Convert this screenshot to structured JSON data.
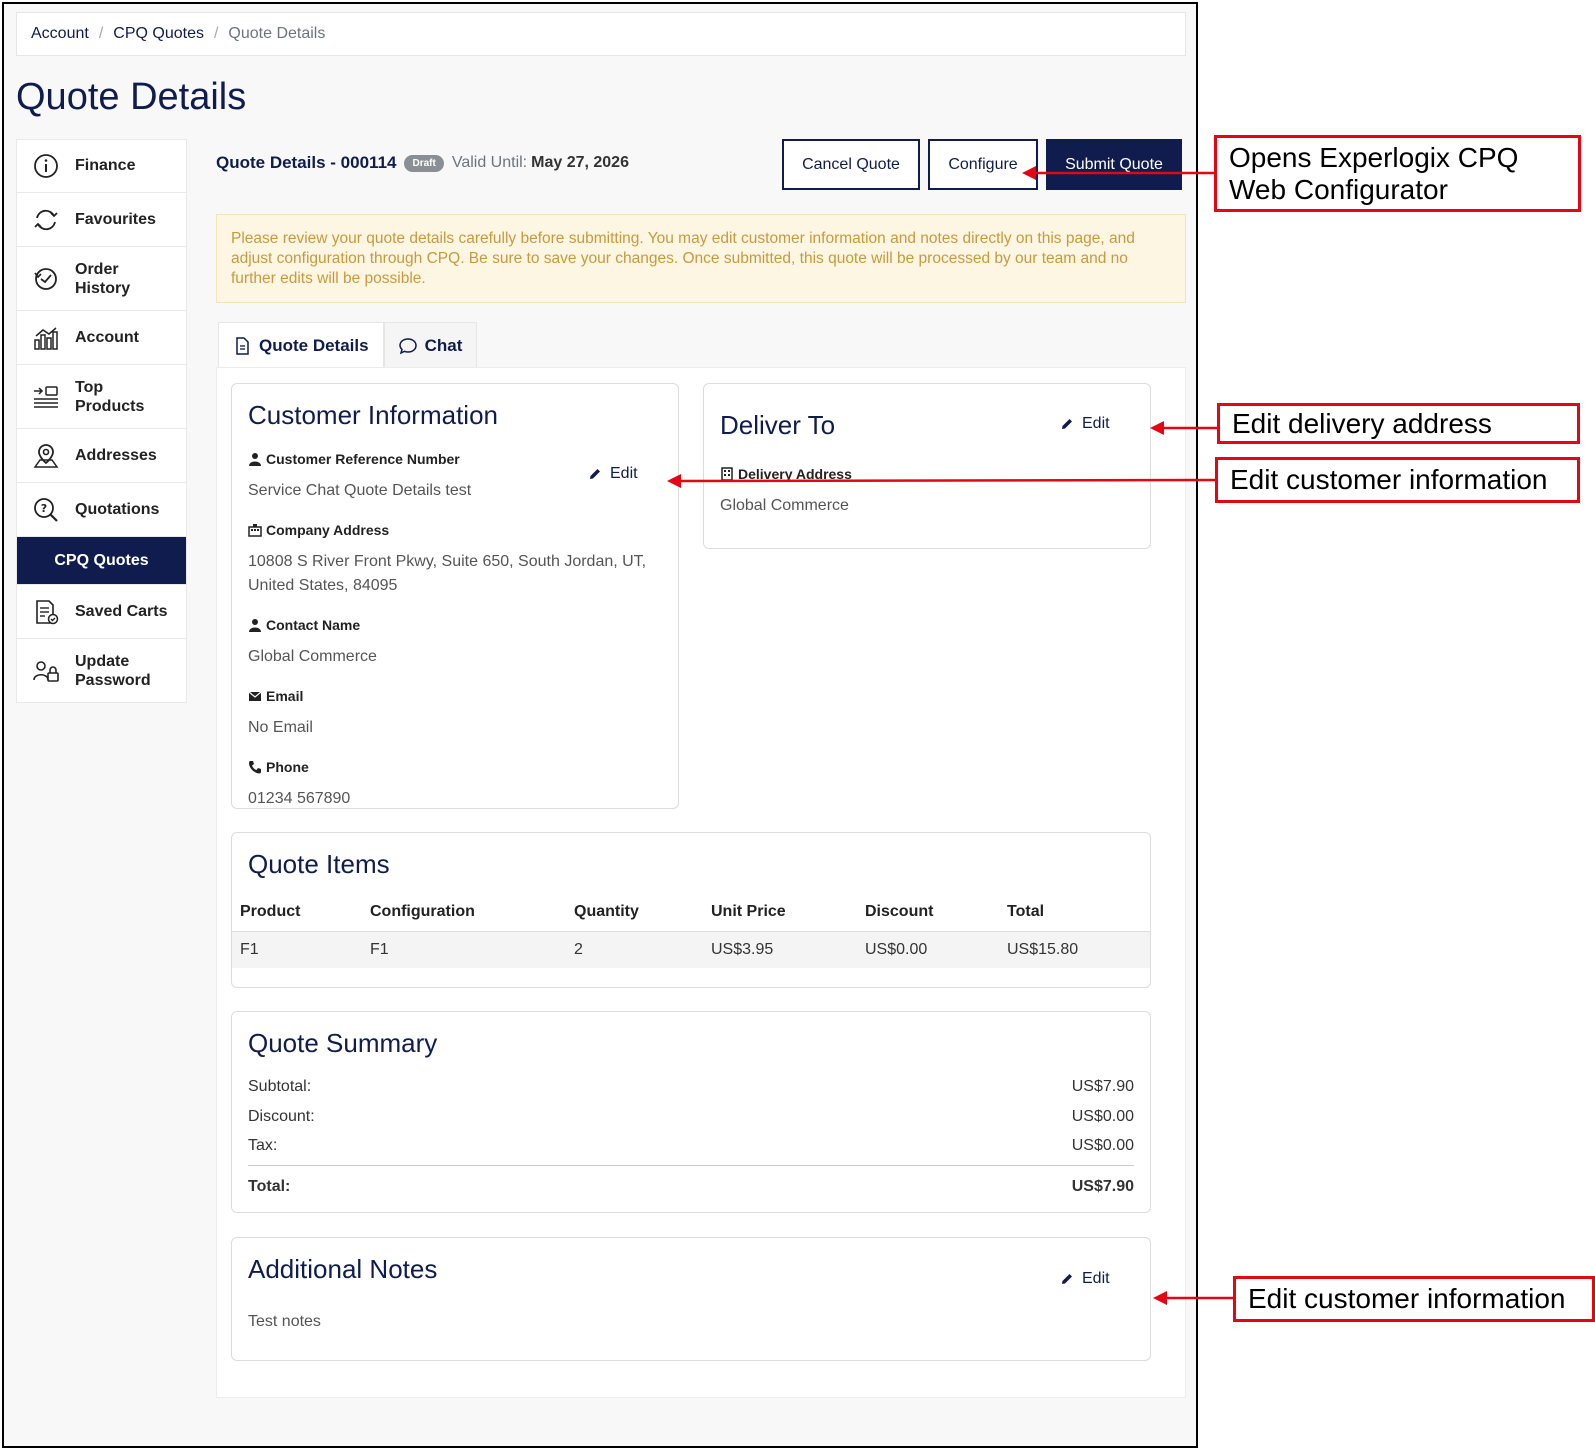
{
  "breadcrumb": {
    "items": [
      "Account",
      "CPQ Quotes"
    ],
    "current": "Quote Details"
  },
  "page_title": "Quote Details",
  "sidebar": {
    "items": [
      {
        "label": "Finance",
        "icon": "info-icon"
      },
      {
        "label": "Favourites",
        "icon": "sync-icon"
      },
      {
        "label": "Order\nHistory",
        "icon": "history-icon"
      },
      {
        "label": "Account",
        "icon": "chart-icon"
      },
      {
        "label": "Top\nProducts",
        "icon": "list-icon"
      },
      {
        "label": "Addresses",
        "icon": "location-icon"
      },
      {
        "label": "Quotations",
        "icon": "search-icon"
      },
      {
        "label": "CPQ Quotes",
        "icon": ""
      },
      {
        "label": "Saved Carts",
        "icon": "document-icon"
      },
      {
        "label": "Update\nPassword",
        "icon": "lock-icon"
      }
    ]
  },
  "quote": {
    "title": "Quote Details - 000114",
    "status": "Draft",
    "valid_label": "Valid Until:",
    "valid_date": "May 27, 2026"
  },
  "actions": {
    "cancel": "Cancel Quote",
    "configure": "Configure",
    "submit": "Submit Quote"
  },
  "notice": "Please review your quote details carefully before submitting. You may edit customer information and notes directly on this page, and adjust configuration through CPQ. Be sure to save your changes. Once submitted, this quote will be processed by our team and no further edits will be possible.",
  "tabs": [
    {
      "label": "Quote Details"
    },
    {
      "label": "Chat"
    }
  ],
  "customer": {
    "heading": "Customer Information",
    "edit": "Edit",
    "ref_label": "Customer Reference Number",
    "ref_value": "Service Chat Quote Details test",
    "address_label": "Company Address",
    "address_value": "10808 S River Front Pkwy, Suite 650, South Jordan, UT, United States, 84095",
    "contact_label": "Contact Name",
    "contact_value": "Global Commerce",
    "email_label": "Email",
    "email_value": "No Email",
    "phone_label": "Phone",
    "phone_value": "01234 567890"
  },
  "deliver": {
    "heading": "Deliver To",
    "edit": "Edit",
    "address_label": "Delivery Address",
    "address_value": "Global Commerce"
  },
  "items": {
    "heading": "Quote Items",
    "columns": [
      "Product",
      "Configuration",
      "Quantity",
      "Unit Price",
      "Discount",
      "Total"
    ],
    "rows": [
      [
        "F1",
        "F1",
        "2",
        "US$3.95",
        "US$0.00",
        "US$15.80"
      ]
    ]
  },
  "summary": {
    "heading": "Quote Summary",
    "subtotal_label": "Subtotal:",
    "subtotal": "US$7.90",
    "discount_label": "Discount:",
    "discount": "US$0.00",
    "tax_label": "Tax:",
    "tax": "US$0.00",
    "total_label": "Total:",
    "total": "US$7.90"
  },
  "notes": {
    "heading": "Additional Notes",
    "edit": "Edit",
    "value": "Test notes"
  },
  "callouts": {
    "configure": "Opens Experlogix CPQ\nWeb Configurator",
    "delivery": "Edit delivery address",
    "customer": "Edit customer information",
    "notes": "Edit customer information"
  },
  "colors": {
    "navy": "#0f1c4d",
    "callout_red": "#e30613",
    "notice_bg": "#fdf6e3",
    "discount_green": "#3f8a3f"
  }
}
